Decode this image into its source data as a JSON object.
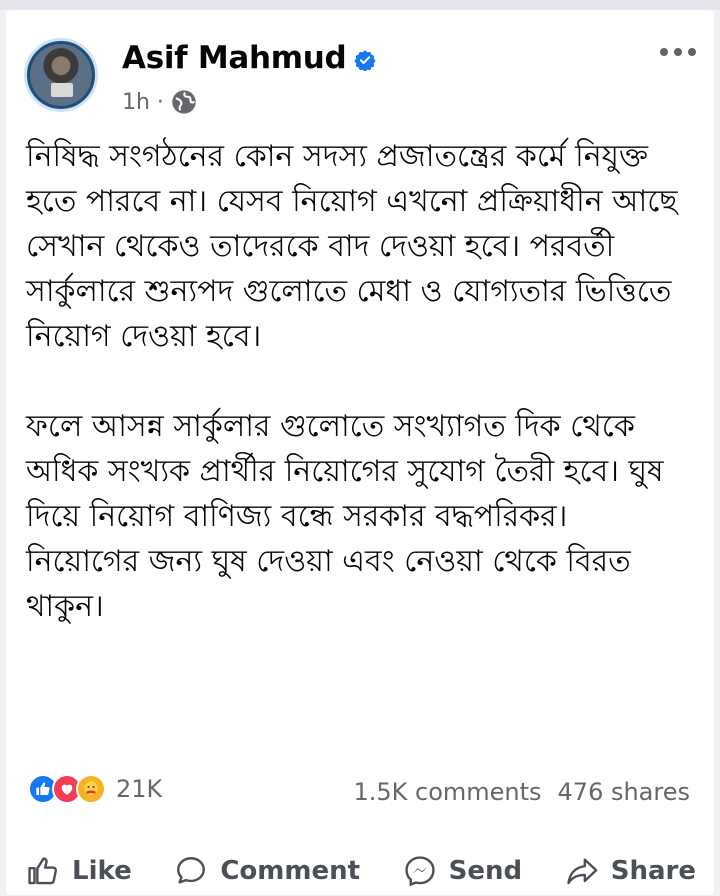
{
  "post": {
    "author": "Asif Mahmud",
    "time": "1h ·",
    "text": [
      "নিষিদ্ধ সংগঠনের কোন সদস্য প্রজাতন্ত্রের কর্মে নিযুক্ত হতে পারবে না। যেসব নিয়োগ এখনো প্রক্রিয়াধীন আছে সেখান থেকেও তাদেরকে বাদ দেওয়া হবে। পরবর্তী সার্কুলারে শুন্যপদ গুলোতে মেধা ও যোগ্যতার ভিত্তিতে নিয়োগ দেওয়া হবে।",
      "ফলে আসন্ন সার্কুলার গুলোতে সংখ্যাগত দিক থেকে অধিক সংখ্যক প্রার্থীর নিয়োগের সুযোগ তৈরী হবে। ঘুষ দিয়ে নিয়োগ বাণিজ্য বন্ধে সরকার বদ্ধপরিকর। নিয়োগের জন্য ঘুষ দেওয়া এবং নেওয়া থেকে বিরত থাকুন।"
    ],
    "reactions_count": "21K",
    "comments": "1.5K comments",
    "shares": "476 shares"
  },
  "actions": {
    "like": "Like",
    "comment": "Comment",
    "send": "Send",
    "share": "Share"
  },
  "icons": {
    "verified": "verified-badge-icon",
    "privacy": "globe-icon",
    "more": "more-options-icon",
    "reactions": [
      "like-reaction-icon",
      "love-reaction-icon",
      "care-reaction-icon"
    ]
  },
  "colors": {
    "brand_blue": "#1877f2",
    "love_red": "#f33e58",
    "care_yellow": "#f7b125",
    "secondary_text": "#65676b"
  }
}
